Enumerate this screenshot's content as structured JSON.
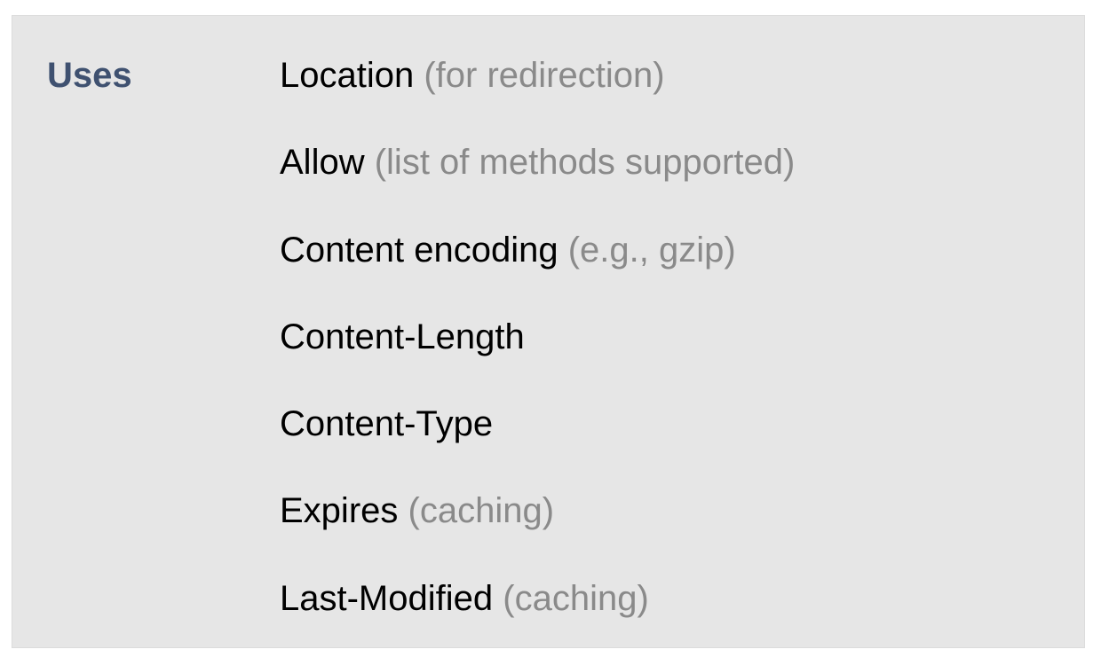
{
  "section": {
    "label": "Uses",
    "label_color": "#3f5170",
    "background_color": "#e6e6e6",
    "note_color": "#8a8a8a"
  },
  "items": [
    {
      "name": "Location",
      "note": "(for redirection)"
    },
    {
      "name": "Allow",
      "note": "(list of methods supported)"
    },
    {
      "name": "Content encoding",
      "note": "(e.g., gzip)"
    },
    {
      "name": "Content-Length",
      "note": ""
    },
    {
      "name": "Content-Type",
      "note": ""
    },
    {
      "name": "Expires",
      "note": "(caching)"
    },
    {
      "name": "Last-Modified",
      "note": "(caching)"
    }
  ]
}
